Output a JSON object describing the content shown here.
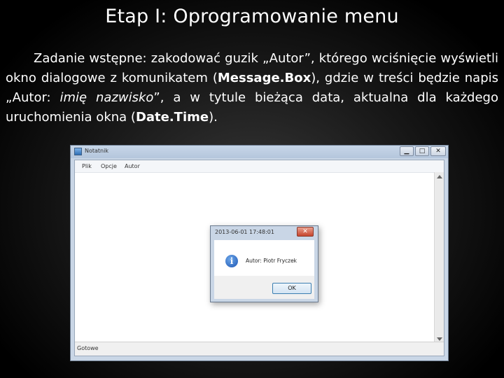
{
  "slide": {
    "title": "Etap I: Oprogramowanie menu",
    "paragraph": {
      "p1": "Zadanie wstępne: zakodować guzik „Autor”, którego wciśnięcie wyświetli okno dialogowe z komunikatem (",
      "b1": "Message.Box",
      "p2": "), gdzie w treści będzie napis „Autor: ",
      "i1": "imię nazwisko",
      "p3": "”, a w tytule bieżąca data, aktualna dla każdego uruchomienia okna (",
      "b2": "Date.Time",
      "p4": ")."
    }
  },
  "notepad": {
    "title": "Notatnik",
    "menu": [
      "Plik",
      "Opcje",
      "Autor"
    ],
    "status": "Gotowe",
    "controls": {
      "minimize": "▁",
      "maximize": "□",
      "close": "✕"
    }
  },
  "dialog": {
    "title": "2013-06-01 17:48:01",
    "message": "Autor: Piotr Fryczek",
    "ok_label": "OK",
    "close": "✕",
    "icon": "i"
  }
}
